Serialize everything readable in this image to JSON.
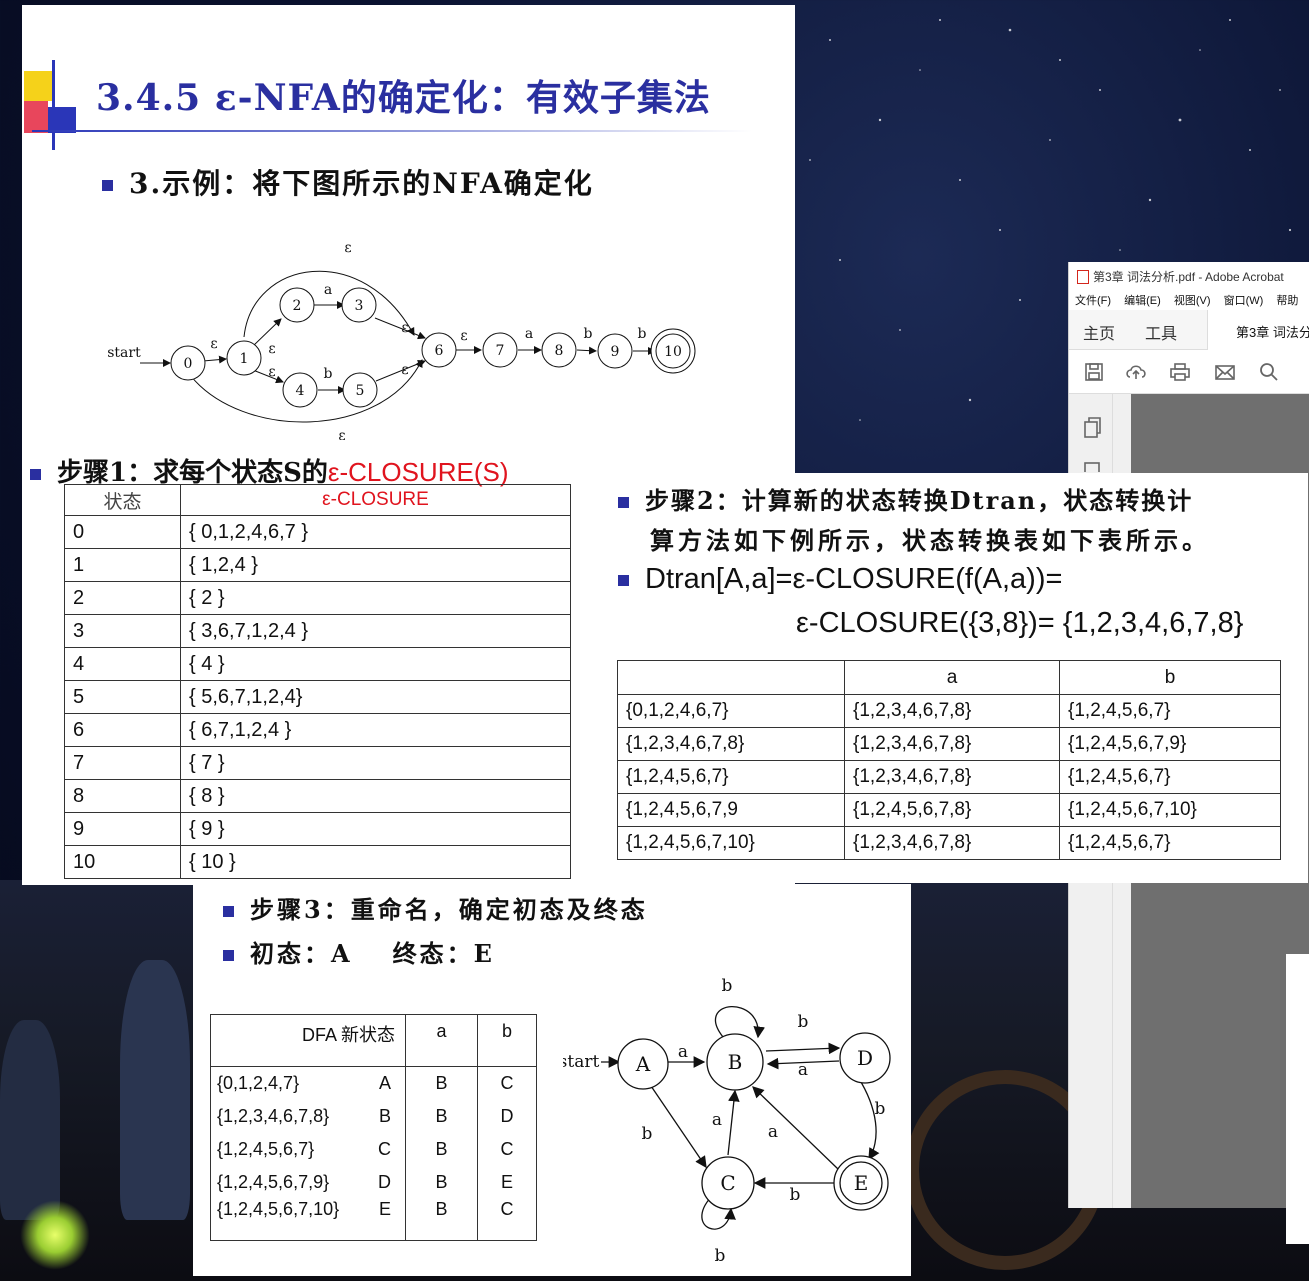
{
  "slide1": {
    "title": "3.4.5 ε-NFA的确定化：有效子集法",
    "example": "3.示例：将下图所示的NFA确定化",
    "nfa": {
      "start_label": "start",
      "states": [
        "0",
        "1",
        "2",
        "3",
        "4",
        "5",
        "6",
        "7",
        "8",
        "9",
        "10"
      ],
      "edge_labels": {
        "top_loop": "ε",
        "bottom_loop": "ε",
        "e0_1": "ε",
        "e1_2": "ε",
        "e1_4": "ε",
        "e2_3": "a",
        "e4_5": "b",
        "e3_6": "ε",
        "e5_6": "ε",
        "e6_7": "ε",
        "e7_8": "a",
        "e8_9": "b",
        "e9_10": "b"
      }
    },
    "step1_prefix": "步骤1：求每个状态S的",
    "step1_highlight": "ε-CLOSURE(S)",
    "closure_table": {
      "headers": [
        "状态",
        "ε-CLOSURE"
      ],
      "rows": [
        [
          "0",
          "{ 0,1,2,4,6,7 }"
        ],
        [
          "1",
          "{ 1,2,4 }"
        ],
        [
          "2",
          "{ 2 }"
        ],
        [
          "3",
          "{ 3,6,7,1,2,4 }"
        ],
        [
          "4",
          "{ 4 }"
        ],
        [
          "5",
          "{ 5,6,7,1,2,4}"
        ],
        [
          "6",
          "{ 6,7,1,2,4 }"
        ],
        [
          "7",
          "{ 7 }"
        ],
        [
          "8",
          "{ 8 }"
        ],
        [
          "9",
          "{ 9 }"
        ],
        [
          "10",
          "{ 10 }"
        ]
      ]
    }
  },
  "acrobat": {
    "title": "第3章 词法分析.pdf - Adobe Acrobat",
    "menu": [
      "文件(F)",
      "编辑(E)",
      "视图(V)",
      "窗口(W)",
      "帮助"
    ],
    "tabs": [
      "主页",
      "工具"
    ],
    "doc_tab": "第3章 词法分",
    "tools": [
      "save-icon",
      "upload-icon",
      "print-icon",
      "mail-icon",
      "search-icon"
    ],
    "side": [
      "copy-icon",
      "page-icon"
    ]
  },
  "slide2": {
    "line1": "步骤2：计算新的状态转换Dtran，状态转换计",
    "line2": "算方法如下例所示，状态转换表如下表所示。",
    "line3": "Dtran[A,a]=ε-CLOSURE(f(A,a))=",
    "line4": "ε-CLOSURE({3,8})= {1,2,3,4,6,7,8}",
    "dtran_table": {
      "headers": [
        "",
        "a",
        "b"
      ],
      "rows": [
        [
          "{0,1,2,4,6,7}",
          "{1,2,3,4,6,7,8}",
          "{1,2,4,5,6,7}"
        ],
        [
          "{1,2,3,4,6,7,8}",
          "{1,2,3,4,6,7,8}",
          "{1,2,4,5,6,7,9}"
        ],
        [
          "{1,2,4,5,6,7}",
          "{1,2,3,4,6,7,8}",
          "{1,2,4,5,6,7}"
        ],
        [
          "{1,2,4,5,6,7,9",
          "{1,2,4,5,6,7,8}",
          "{1,2,4,5,6,7,10}"
        ],
        [
          "{1,2,4,5,6,7,10}",
          "{1,2,3,4,6,7,8}",
          "{1,2,4,5,6,7}"
        ]
      ]
    }
  },
  "slide3": {
    "line1": "步骤3：重命名，确定初态及终态",
    "initial": "初态：A",
    "final": "终态：E",
    "dfa_table": {
      "headers": [
        "DFA 新状态",
        "a",
        "b"
      ],
      "rows": [
        [
          "{0,1,2,4,7}",
          "A",
          "B",
          "C"
        ],
        [
          "{1,2,3,4,6,7,8}",
          "B",
          "B",
          "D"
        ],
        [
          "{1,2,4,5,6,7}",
          "C",
          "B",
          "C"
        ],
        [
          "{1,2,4,5,6,7,9}",
          "D",
          "B",
          "E"
        ],
        [
          "{1,2,4,5,6,7,10}",
          "E",
          "B",
          "C"
        ]
      ]
    },
    "dfa": {
      "start_label": "start",
      "states": [
        "A",
        "B",
        "C",
        "D",
        "E"
      ],
      "labels": {
        "AB": "a",
        "AC": "b",
        "BB": "b",
        "BD": "b",
        "DB": "a",
        "DE": "b",
        "EB": "a",
        "CB": "a",
        "EC": "b",
        "CC": "b"
      }
    }
  }
}
